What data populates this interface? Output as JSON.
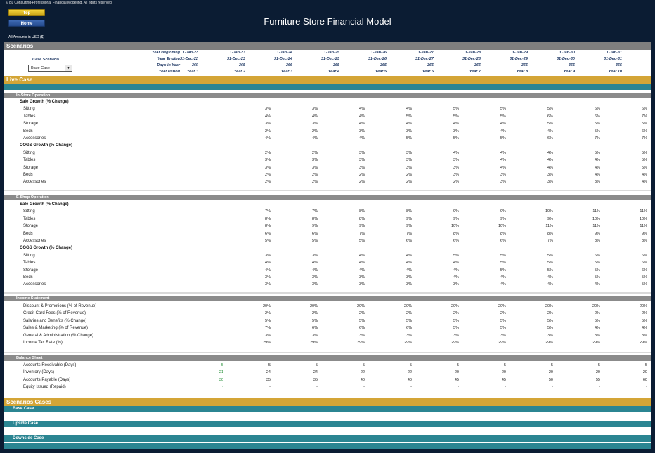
{
  "copyright": "© BL Consulting-Professional Financial Modeling. All rights reserved.",
  "nav": {
    "top": "Top",
    "home": "Home"
  },
  "title": "Furniture Store Financial Model",
  "amounts_note": "All Amounts in  USD ($)",
  "scenarios_title": "Scenarios",
  "header": {
    "labels": [
      "Year Beginning",
      "Year Ending",
      "Days in Year",
      "Year Period"
    ],
    "case_label": "Case Scenario",
    "case_value": "Base Case",
    "year_beginning": [
      "1-Jan-22",
      "1-Jan-23",
      "1-Jan-24",
      "1-Jan-25",
      "1-Jan-26",
      "1-Jan-27",
      "1-Jan-28",
      "1-Jan-29",
      "1-Jan-30",
      "1-Jan-31"
    ],
    "year_ending": [
      "31-Dec-22",
      "31-Dec-23",
      "31-Dec-24",
      "31-Dec-25",
      "31-Dec-26",
      "31-Dec-27",
      "31-Dec-28",
      "31-Dec-29",
      "31-Dec-30",
      "31-Dec-31"
    ],
    "days": [
      "365",
      "365",
      "366",
      "365",
      "365",
      "365",
      "366",
      "365",
      "365",
      "365"
    ],
    "period": [
      "Year 1",
      "Year 2",
      "Year 3",
      "Year 4",
      "Year 5",
      "Year 6",
      "Year 7",
      "Year 8",
      "Year 9",
      "Year 10"
    ]
  },
  "live_case": "Live Case",
  "in_store": {
    "title": "In-Store Operation",
    "sale_title": "Sale Growth (% Change)",
    "sale": [
      {
        "label": "Sitting",
        "values": [
          "3%",
          "3%",
          "4%",
          "4%",
          "5%",
          "5%",
          "5%",
          "6%",
          "6%"
        ]
      },
      {
        "label": "Tables",
        "values": [
          "4%",
          "4%",
          "4%",
          "5%",
          "5%",
          "5%",
          "6%",
          "6%",
          "7%"
        ]
      },
      {
        "label": "Storage",
        "values": [
          "3%",
          "3%",
          "4%",
          "4%",
          "4%",
          "4%",
          "5%",
          "5%",
          "5%"
        ]
      },
      {
        "label": "Beds",
        "values": [
          "2%",
          "2%",
          "3%",
          "3%",
          "3%",
          "4%",
          "4%",
          "5%",
          "6%"
        ]
      },
      {
        "label": "Accessories",
        "values": [
          "4%",
          "4%",
          "4%",
          "5%",
          "5%",
          "5%",
          "6%",
          "7%",
          "7%"
        ]
      }
    ],
    "cogs_title": "COGS Growth (% Change)",
    "cogs": [
      {
        "label": "Sitting",
        "values": [
          "2%",
          "2%",
          "3%",
          "3%",
          "4%",
          "4%",
          "4%",
          "5%",
          "5%"
        ]
      },
      {
        "label": "Tables",
        "values": [
          "3%",
          "3%",
          "3%",
          "3%",
          "3%",
          "4%",
          "4%",
          "4%",
          "5%"
        ]
      },
      {
        "label": "Storage",
        "values": [
          "3%",
          "3%",
          "3%",
          "3%",
          "3%",
          "4%",
          "4%",
          "4%",
          "5%"
        ]
      },
      {
        "label": "Beds",
        "values": [
          "2%",
          "2%",
          "2%",
          "2%",
          "3%",
          "3%",
          "3%",
          "4%",
          "4%"
        ]
      },
      {
        "label": "Accessories",
        "values": [
          "2%",
          "2%",
          "2%",
          "2%",
          "2%",
          "3%",
          "3%",
          "3%",
          "4%"
        ]
      }
    ]
  },
  "eshop": {
    "title": "E-Shop Operation",
    "sale_title": "Sale Growth (% Change)",
    "sale": [
      {
        "label": "Sitting",
        "values": [
          "7%",
          "7%",
          "8%",
          "8%",
          "9%",
          "9%",
          "10%",
          "11%",
          "11%"
        ]
      },
      {
        "label": "Tables",
        "values": [
          "8%",
          "8%",
          "8%",
          "9%",
          "9%",
          "9%",
          "9%",
          "10%",
          "10%"
        ]
      },
      {
        "label": "Storage",
        "values": [
          "8%",
          "9%",
          "9%",
          "9%",
          "10%",
          "10%",
          "11%",
          "11%",
          "11%"
        ]
      },
      {
        "label": "Beds",
        "values": [
          "6%",
          "6%",
          "7%",
          "7%",
          "8%",
          "8%",
          "8%",
          "9%",
          "9%"
        ]
      },
      {
        "label": "Accessories",
        "values": [
          "5%",
          "5%",
          "5%",
          "6%",
          "6%",
          "6%",
          "7%",
          "8%",
          "8%"
        ]
      }
    ],
    "cogs_title": "COGS Growth (% Change)",
    "cogs": [
      {
        "label": "Sitting",
        "values": [
          "3%",
          "3%",
          "4%",
          "4%",
          "5%",
          "5%",
          "5%",
          "6%",
          "6%"
        ]
      },
      {
        "label": "Tables",
        "values": [
          "4%",
          "4%",
          "4%",
          "4%",
          "4%",
          "5%",
          "5%",
          "5%",
          "6%"
        ]
      },
      {
        "label": "Storage",
        "values": [
          "4%",
          "4%",
          "4%",
          "4%",
          "4%",
          "5%",
          "5%",
          "5%",
          "6%"
        ]
      },
      {
        "label": "Beds",
        "values": [
          "3%",
          "3%",
          "3%",
          "3%",
          "4%",
          "4%",
          "4%",
          "5%",
          "5%"
        ]
      },
      {
        "label": "Accessories",
        "values": [
          "3%",
          "3%",
          "3%",
          "3%",
          "3%",
          "4%",
          "4%",
          "4%",
          "5%"
        ]
      }
    ]
  },
  "income": {
    "title": "Income Statement",
    "rows": [
      {
        "label": "Discount & Promotions (% of Revenue)",
        "values": [
          "20%",
          "20%",
          "20%",
          "20%",
          "20%",
          "20%",
          "20%",
          "20%",
          "20%"
        ]
      },
      {
        "label": "Credit Card Fees (% of Revenue)",
        "values": [
          "2%",
          "2%",
          "2%",
          "2%",
          "2%",
          "2%",
          "2%",
          "2%",
          "2%"
        ]
      },
      {
        "label": "Salaries and Benefits (% Change)",
        "values": [
          "5%",
          "5%",
          "5%",
          "5%",
          "5%",
          "5%",
          "5%",
          "5%",
          "5%"
        ]
      },
      {
        "label": "Sales & Marketing (% of Revenue)",
        "values": [
          "7%",
          "6%",
          "6%",
          "6%",
          "5%",
          "5%",
          "5%",
          "4%",
          "4%"
        ]
      },
      {
        "label": "General & Administration (% Change)",
        "values": [
          "3%",
          "3%",
          "3%",
          "3%",
          "3%",
          "3%",
          "3%",
          "3%",
          "3%"
        ]
      },
      {
        "label": "Income Tax Rate (%)",
        "values": [
          "29%",
          "29%",
          "29%",
          "29%",
          "29%",
          "29%",
          "29%",
          "29%",
          "29%"
        ]
      }
    ]
  },
  "balance": {
    "title": "Balance Sheet",
    "rows": [
      {
        "label": "Accounts Receivable (Days)",
        "first": "5",
        "values": [
          "5",
          "5",
          "5",
          "5",
          "5",
          "5",
          "5",
          "5",
          "5"
        ]
      },
      {
        "label": "Inventory (Days)",
        "first": "21",
        "values": [
          "24",
          "24",
          "22",
          "22",
          "20",
          "20",
          "20",
          "20",
          "20"
        ]
      },
      {
        "label": "Accounts Payable (Days)",
        "first": "30",
        "values": [
          "35",
          "35",
          "40",
          "40",
          "45",
          "45",
          "50",
          "55",
          "60"
        ]
      },
      {
        "label": "Equity Issued (Repaid)",
        "first": "-",
        "values": [
          "-",
          "-",
          "-",
          "-",
          "-",
          "-",
          "-",
          "-",
          "-"
        ]
      }
    ]
  },
  "scenario_cases": {
    "title": "Scenarios Cases",
    "cases": [
      "Base Case",
      "Upside Case",
      "Downside Case"
    ]
  },
  "colors": {
    "navy": "#0b1c33",
    "gold": "#d4a536",
    "teal": "#2b8592",
    "grey": "#7f7f7f",
    "green": "#1a8a2e"
  }
}
